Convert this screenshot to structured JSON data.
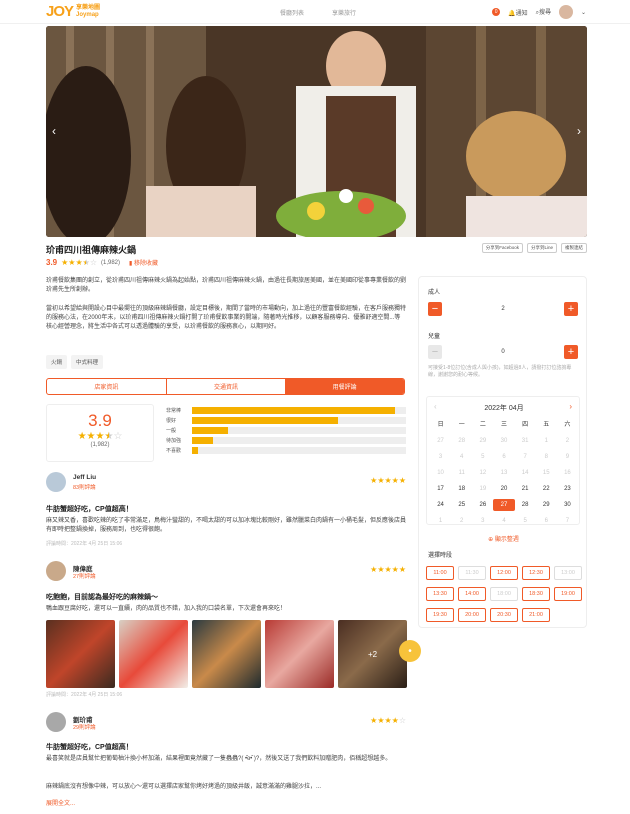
{
  "header": {
    "logo_mark": "JOY",
    "logo_line1": "享樂地圖",
    "logo_line2": "Joymap",
    "nav": [
      "餐廳列表",
      "享樂旅行"
    ],
    "notify_label": "通知",
    "search_label": "搜尋",
    "notify_count": "0"
  },
  "restaurant": {
    "name": "玠甫四川祖傳麻辣火鍋",
    "rating": "3.9",
    "rating_stars": 3.5,
    "review_count": "(1,982)",
    "favorite_label": "移除收藏",
    "share": [
      "分享到Facebook",
      "分享到Line",
      "複製連結"
    ],
    "desc1": "玠甫餐飲集團的創立，從玠甫四川祖傳麻辣火鍋為起始點，玠甫四川祖傳麻辣火鍋，由過往長期旅居美國，並在美國印從事專業餐飲的劉玠甫先生所創辦。",
    "desc2": "當初以希望給與開設心目中最嚮往的頂級麻辣鍋餐廳，設定目標後，期間了當時的市場動向，加上過往的豐富餐飲經驗，在客戶服務獨特的服務心法，在2000年末，以玠甫四川祖傳麻辣火鍋打開了玠甫餐飲事業的開端，隨著時光推移，以顧客服務導向、優雅舒適空間...等核心經營理念，將生活中各式可以透過體驗的享受，以玠甫餐飲的服務衷心，以期同好。",
    "tags": [
      "火鍋",
      "中式料理"
    ]
  },
  "tabs": [
    "店家資訊",
    "交通資訊",
    "用餐評論"
  ],
  "summary": {
    "rating": "3.9",
    "stars": 3.5,
    "count": "(1,982)",
    "bars": [
      {
        "label": "非常棒",
        "value": 0.95
      },
      {
        "label": "很好",
        "value": 0.68
      },
      {
        "label": "一般",
        "value": 0.17
      },
      {
        "label": "待加強",
        "value": 0.1
      },
      {
        "label": "不喜歡",
        "value": 0.03
      }
    ]
  },
  "reviews": [
    {
      "name": "Jeff Liu",
      "count": "83則評論",
      "stars": 5,
      "title": "牛肪蟹超好吃，CP值超高！",
      "body": "麻又辣又香，喜歡吃辣的吃了非常滿足，鳥梅汁蠻甜的，不喝太甜的可以加冰塊比較剛好，雖然臘菜白肉鍋有一小桶毛髮，但反應後店員有即時把整鍋換掉，服務周到，也吃得很飽。",
      "date": "評論時間：2022年 4月 25日 15:06"
    },
    {
      "name": "陳偉庭",
      "count": "27則評論",
      "stars": 5,
      "title": "吃飽飽，目前認為最好吃的麻辣鍋～",
      "body": "鴨血跟豆腐好吃，還可以一直續，肉的品質也不錯，加入我的口袋名單，下次還會再來吃！",
      "date": "評論時間：2022年 4月 25日 15:06",
      "photo_more": "+2"
    },
    {
      "name": "劉玠甫",
      "count": "29則評論",
      "stars": 4,
      "title": "牛肪蟹超好吃，CP值超高！",
      "body1": "最喜笑就是店員幫忙把葡萄柚汁換小杯加滿，結果裡面竟然藏了一隻蟲蟲?( •᷄ɞ•᷅ )?，然後又送了我們飲料加贈肥肉，佰稱超想越多。",
      "body2": "麻辣鍋底沒有想像中辣，可以放心～還可以選擇店家幫你烤好烤過的頂級井飯，誠意滿滿的雞腿沙拉，...",
      "expand": "展開全文..."
    }
  ],
  "booking": {
    "adult_label": "成人",
    "adult_value": "2",
    "child_label": "兒童",
    "child_value": "0",
    "note": "可接受1-8位訂位(含成人與小孩)，如超過8人，請撥打訂位諮詢專線，謝謝您的耐心等候。",
    "month": "2022年 04月",
    "weekdays": [
      "日",
      "一",
      "二",
      "三",
      "四",
      "五",
      "六"
    ],
    "days": [
      {
        "d": "27",
        "s": "dim"
      },
      {
        "d": "28",
        "s": "dim"
      },
      {
        "d": "29",
        "s": "dim"
      },
      {
        "d": "30",
        "s": "dim"
      },
      {
        "d": "31",
        "s": "dim"
      },
      {
        "d": "1",
        "s": "dim"
      },
      {
        "d": "2",
        "s": "dim"
      },
      {
        "d": "3",
        "s": "dim"
      },
      {
        "d": "4",
        "s": "dim"
      },
      {
        "d": "5",
        "s": "dim"
      },
      {
        "d": "6",
        "s": "dim"
      },
      {
        "d": "7",
        "s": "dim"
      },
      {
        "d": "8",
        "s": "dim"
      },
      {
        "d": "9",
        "s": "dim"
      },
      {
        "d": "10",
        "s": "dim"
      },
      {
        "d": "11",
        "s": "dim"
      },
      {
        "d": "12",
        "s": "dim"
      },
      {
        "d": "13",
        "s": "dim"
      },
      {
        "d": "14",
        "s": "dim"
      },
      {
        "d": "15",
        "s": "dim"
      },
      {
        "d": "16",
        "s": "dim"
      },
      {
        "d": "17",
        "s": ""
      },
      {
        "d": "18",
        "s": ""
      },
      {
        "d": "19",
        "s": "dim"
      },
      {
        "d": "20",
        "s": ""
      },
      {
        "d": "21",
        "s": ""
      },
      {
        "d": "22",
        "s": ""
      },
      {
        "d": "23",
        "s": ""
      },
      {
        "d": "24",
        "s": ""
      },
      {
        "d": "25",
        "s": ""
      },
      {
        "d": "26",
        "s": ""
      },
      {
        "d": "27",
        "s": "sel"
      },
      {
        "d": "28",
        "s": ""
      },
      {
        "d": "29",
        "s": ""
      },
      {
        "d": "30",
        "s": ""
      },
      {
        "d": "1",
        "s": "dim"
      },
      {
        "d": "2",
        "s": "dim"
      },
      {
        "d": "3",
        "s": "dim"
      },
      {
        "d": "4",
        "s": "dim"
      },
      {
        "d": "5",
        "s": "dim"
      },
      {
        "d": "6",
        "s": "dim"
      },
      {
        "d": "7",
        "s": "dim"
      }
    ],
    "show_all": "顯示整週",
    "slots_label": "選擇時段",
    "slots": [
      {
        "t": "11:00",
        "on": true
      },
      {
        "t": "11:30",
        "on": false
      },
      {
        "t": "12:00",
        "on": true
      },
      {
        "t": "12:30",
        "on": true
      },
      {
        "t": "13:00",
        "on": false
      },
      {
        "t": "13:30",
        "on": true
      },
      {
        "t": "14:00",
        "on": true
      },
      {
        "t": "18:00",
        "on": false
      },
      {
        "t": "18:30",
        "on": true
      },
      {
        "t": "19:00",
        "on": true
      },
      {
        "t": "19:30",
        "on": true
      },
      {
        "t": "20:00",
        "on": true
      },
      {
        "t": "20:30",
        "on": true
      },
      {
        "t": "21:00",
        "on": true
      }
    ]
  },
  "colors": {
    "accent": "#f05a28",
    "star": "#f5b000",
    "brand": "#f7a11a"
  }
}
